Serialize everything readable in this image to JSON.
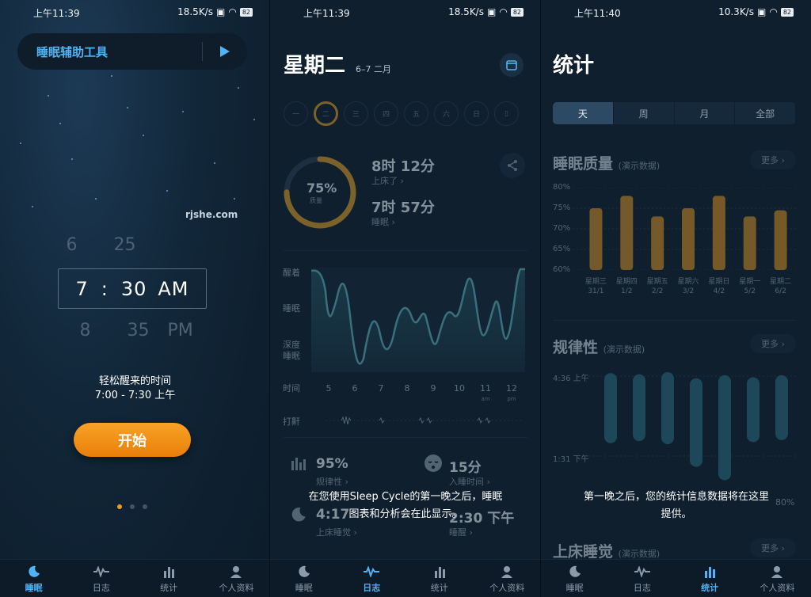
{
  "panels": [
    {
      "status": {
        "time": "上午11:39",
        "speed": "18.5K/s",
        "battery": "82"
      },
      "tool_bar": {
        "label": "睡眠辅助工具"
      },
      "watermark": "rjshe.com",
      "picker": {
        "above": {
          "hour": "6",
          "minute": "25"
        },
        "selected": {
          "hour": "7",
          "sep": ":",
          "minute": "30",
          "ampm": "AM"
        },
        "below": {
          "hour": "8",
          "minute": "35",
          "ampm": "PM"
        }
      },
      "wake": {
        "title": "轻松醒来的时间",
        "range": "7:00 - 7:30 上午"
      },
      "start_label": "开始",
      "page_dots": {
        "count": 3,
        "active": 0
      }
    },
    {
      "status": {
        "time": "上午11:39",
        "speed": "18.5K/s",
        "battery": "82"
      },
      "title": "星期二",
      "date": "6–7 二月",
      "weekdays": [
        "一",
        "二",
        "三",
        "四",
        "五",
        "六",
        "日"
      ],
      "ring": {
        "percent": "75%",
        "sub": "质量",
        "fraction": 0.75
      },
      "in_bed": {
        "value": "8时 12分",
        "label": "上床了 ›"
      },
      "asleep": {
        "value": "7时 57分",
        "label": "睡眠 ›"
      },
      "graph": {
        "y_labels": [
          "醒着",
          "睡眠",
          "深度",
          "睡眠"
        ],
        "x_title": "时间",
        "x_labels": [
          "5",
          "6",
          "7",
          "8",
          "9",
          "10",
          "11",
          "12"
        ],
        "x_sub": {
          "11": "am",
          "12": "pm"
        },
        "snore_label": "打鼾"
      },
      "mini_stats": [
        {
          "value": "95%",
          "label": "规律性 ›"
        },
        {
          "value": "15分",
          "label": "入睡时间 ›"
        },
        {
          "value": "4:17",
          "label": "上床睡觉 ›"
        },
        {
          "value": "2:30 下午",
          "label": "睡醒 ›"
        }
      ],
      "overlay": {
        "line1": "在您使用Sleep Cycle的第一晚之后，睡眠",
        "line2": "图表和分析会在此显示。"
      }
    },
    {
      "status": {
        "time": "上午11:40",
        "speed": "10.3K/s",
        "battery": "82"
      },
      "title": "统计",
      "segments": [
        "天",
        "周",
        "月",
        "全部"
      ],
      "quality": {
        "title": "睡眠质量",
        "tag": "(演示数据)",
        "more": "更多 ›"
      },
      "regularity": {
        "title": "规律性",
        "tag": "(演示数据)",
        "more": "更多 ›",
        "y_top": "4:36 上午",
        "y_bottom": "1:31 下午"
      },
      "bedtime": {
        "title": "上床睡觉",
        "tag": "(演示数据)",
        "more": "更多 ›"
      },
      "overlay": {
        "line1": "第一晚之后，您的统计信息数据将在这里",
        "line2": "提供。"
      },
      "ghost_percent": "80%"
    }
  ],
  "tabs": [
    "睡眠",
    "日志",
    "统计",
    "个人资料"
  ],
  "colors": {
    "accent": "#4fb3f5",
    "orange": "#f29a1c",
    "bar_gold": "#c98a24",
    "bar_teal": "#2a6a80"
  },
  "chart_data": [
    {
      "type": "bar",
      "title": "睡眠质量",
      "categories": [
        "星期三 31/1",
        "星期四 1/2",
        "星期五 2/2",
        "星期六 3/2",
        "星期日 4/2",
        "星期一 5/2",
        "星期二 6/2"
      ],
      "category_lines": [
        [
          "星期三",
          "31/1"
        ],
        [
          "星期四",
          "1/2"
        ],
        [
          "星期五",
          "2/2"
        ],
        [
          "星期六",
          "3/2"
        ],
        [
          "星期日",
          "4/2"
        ],
        [
          "星期一",
          "5/2"
        ],
        [
          "星期二",
          "6/2"
        ]
      ],
      "values": [
        75,
        78,
        73,
        75,
        78,
        73,
        74.5
      ],
      "y_ticks": [
        "80%",
        "75%",
        "70%",
        "65%",
        "60%"
      ],
      "ylim": [
        60,
        80
      ]
    },
    {
      "type": "bar",
      "title": "规律性",
      "series": [
        {
          "start": [
            0.01,
            0.02,
            0.0,
            0.06,
            0.03,
            0.05,
            0.03
          ],
          "end": [
            0.69,
            0.67,
            0.7,
            0.92,
            1.05,
            0.68,
            0.66
          ]
        }
      ],
      "note": "floating ranges between 4:36 上午 and 1:31 下午 (relative)"
    }
  ]
}
